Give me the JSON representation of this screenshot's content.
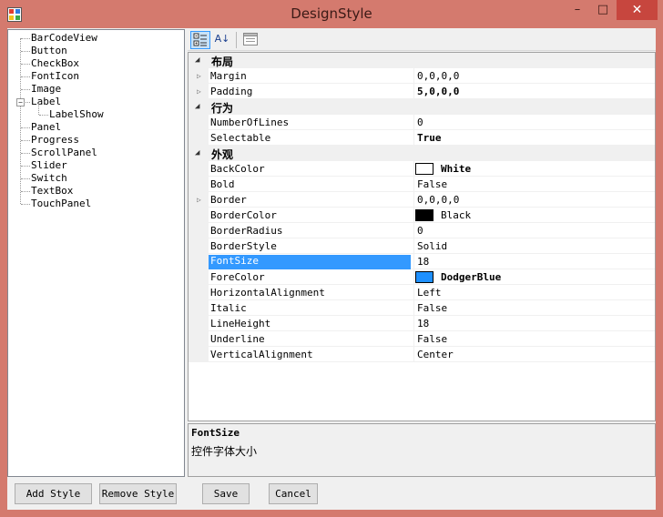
{
  "window": {
    "title": "DesignStyle",
    "minimize_glyph": "–",
    "maximize_glyph": "□",
    "close_glyph": "✕",
    "accent": "#d47a6e",
    "close_color": "#c7463e"
  },
  "tree": {
    "items": [
      {
        "label": "BarCodeView",
        "level": 0
      },
      {
        "label": "Button",
        "level": 0
      },
      {
        "label": "CheckBox",
        "level": 0
      },
      {
        "label": "FontIcon",
        "level": 0
      },
      {
        "label": "Image",
        "level": 0
      },
      {
        "label": "Label",
        "level": 0,
        "expanded": true
      },
      {
        "label": "LabelShow",
        "level": 1
      },
      {
        "label": "Panel",
        "level": 0
      },
      {
        "label": "Progress",
        "level": 0
      },
      {
        "label": "ScrollPanel",
        "level": 0
      },
      {
        "label": "Slider",
        "level": 0
      },
      {
        "label": "Switch",
        "level": 0
      },
      {
        "label": "TextBox",
        "level": 0
      },
      {
        "label": "TouchPanel",
        "level": 0
      }
    ],
    "expander_glyph": "−"
  },
  "toolbar": {
    "categorized_icon": "categorized-icon",
    "alphabetical_icon": "sort-az-icon",
    "alphabetical_glyph": "A↓",
    "pages_icon": "property-pages-icon"
  },
  "grid": {
    "collapse_glyph": "◢",
    "expand_glyph": "▷",
    "categories": [
      {
        "name": "布局",
        "rows": [
          {
            "name": "Margin",
            "value": "0,0,0,0",
            "expandable": true
          },
          {
            "name": "Padding",
            "value": "5,0,0,0",
            "expandable": true,
            "bold": true
          }
        ]
      },
      {
        "name": "行为",
        "rows": [
          {
            "name": "NumberOfLines",
            "value": "0"
          },
          {
            "name": "Selectable",
            "value": "True",
            "bold": true
          }
        ]
      },
      {
        "name": "外观",
        "rows": [
          {
            "name": "BackColor",
            "value": "White",
            "bold": true,
            "swatch": "#ffffff"
          },
          {
            "name": "Bold",
            "value": "False"
          },
          {
            "name": "Border",
            "value": "0,0,0,0",
            "expandable": true
          },
          {
            "name": "BorderColor",
            "value": "Black",
            "swatch": "#000000"
          },
          {
            "name": "BorderRadius",
            "value": "0"
          },
          {
            "name": "BorderStyle",
            "value": "Solid"
          },
          {
            "name": "FontSize",
            "value": "18",
            "selected": true
          },
          {
            "name": "ForeColor",
            "value": "DodgerBlue",
            "bold": true,
            "swatch": "#1e90ff"
          },
          {
            "name": "HorizontalAlignment",
            "value": "Left"
          },
          {
            "name": "Italic",
            "value": "False"
          },
          {
            "name": "LineHeight",
            "value": "18"
          },
          {
            "name": "Underline",
            "value": "False"
          },
          {
            "name": "VerticalAlignment",
            "value": "Center"
          }
        ]
      }
    ]
  },
  "description": {
    "title": "FontSize",
    "text": "控件字体大小"
  },
  "buttons": {
    "add_style": "Add Style",
    "remove_style": "Remove Style",
    "save": "Save",
    "cancel": "Cancel"
  }
}
